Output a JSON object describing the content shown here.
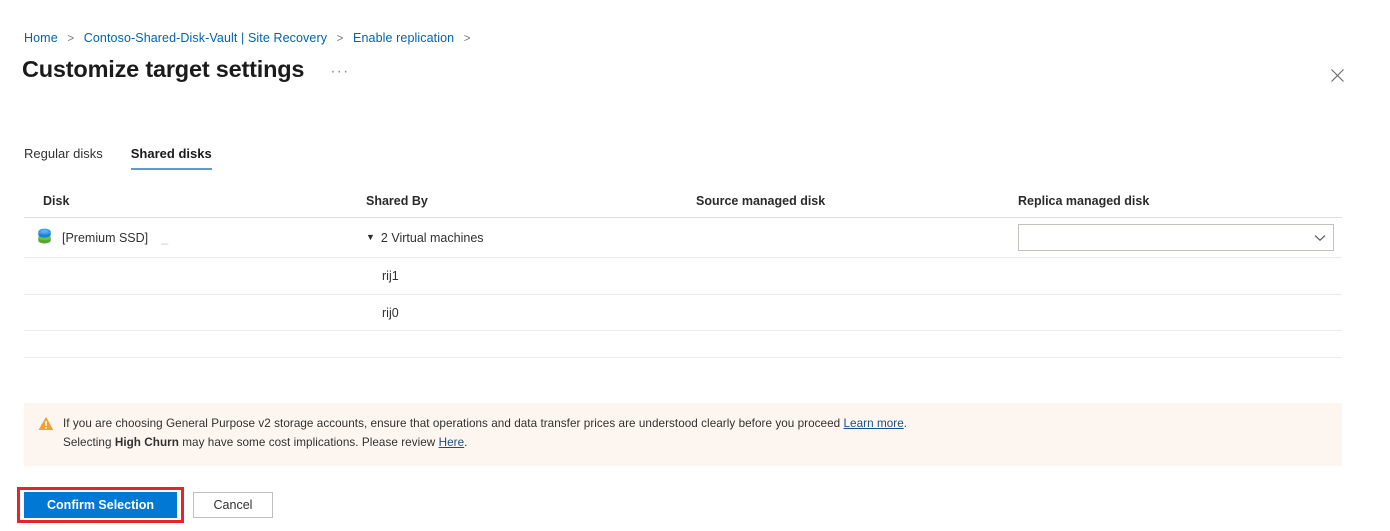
{
  "breadcrumb": {
    "items": [
      {
        "label": "Home"
      },
      {
        "label": "Contoso-Shared-Disk-Vault | Site Recovery"
      },
      {
        "label": "Enable replication"
      }
    ],
    "separator": ">"
  },
  "header": {
    "title": "Customize target settings",
    "more_menu": "···",
    "close_icon": "close-icon"
  },
  "tabs": [
    {
      "label": "Regular disks",
      "active": false
    },
    {
      "label": "Shared disks",
      "active": true
    }
  ],
  "table": {
    "columns": [
      "Disk",
      "Shared By",
      "Source managed disk",
      "Replica managed disk"
    ],
    "rows": [
      {
        "icon": "managed-disk-icon",
        "disk": "[Premium SSD]",
        "disk_suffix": "_",
        "expander": "▼",
        "shared_by": "2 Virtual machines",
        "source_managed_disk": "",
        "replica_managed_disk": "",
        "replica_placeholder": "",
        "chevron": "⌄"
      },
      {
        "shared_by": "rij1"
      },
      {
        "shared_by": "rij0"
      }
    ]
  },
  "warning": {
    "icon": "warning-triangle-icon",
    "line1_before": "If you are choosing General Purpose v2 storage accounts, ensure that operations and data transfer prices are understood clearly before you proceed ",
    "line1_link": "Learn more",
    "line1_after": ".",
    "line2_before": "Selecting ",
    "line2_bold": "High Churn",
    "line2_middle": " may have some cost implications. Please review ",
    "line2_link": "Here",
    "line2_after": "."
  },
  "footer": {
    "confirm_label": "Confirm Selection",
    "cancel_label": "Cancel"
  },
  "colors": {
    "primary_button": "#0078d4",
    "breadcrumb_link": "#0063b1",
    "tab_underline": "#5b9bd5",
    "warning_background": "#fdf6f0",
    "warning_icon": "#e8a33d",
    "highlight_box": "#e8232a",
    "link": "#1c4f82"
  }
}
